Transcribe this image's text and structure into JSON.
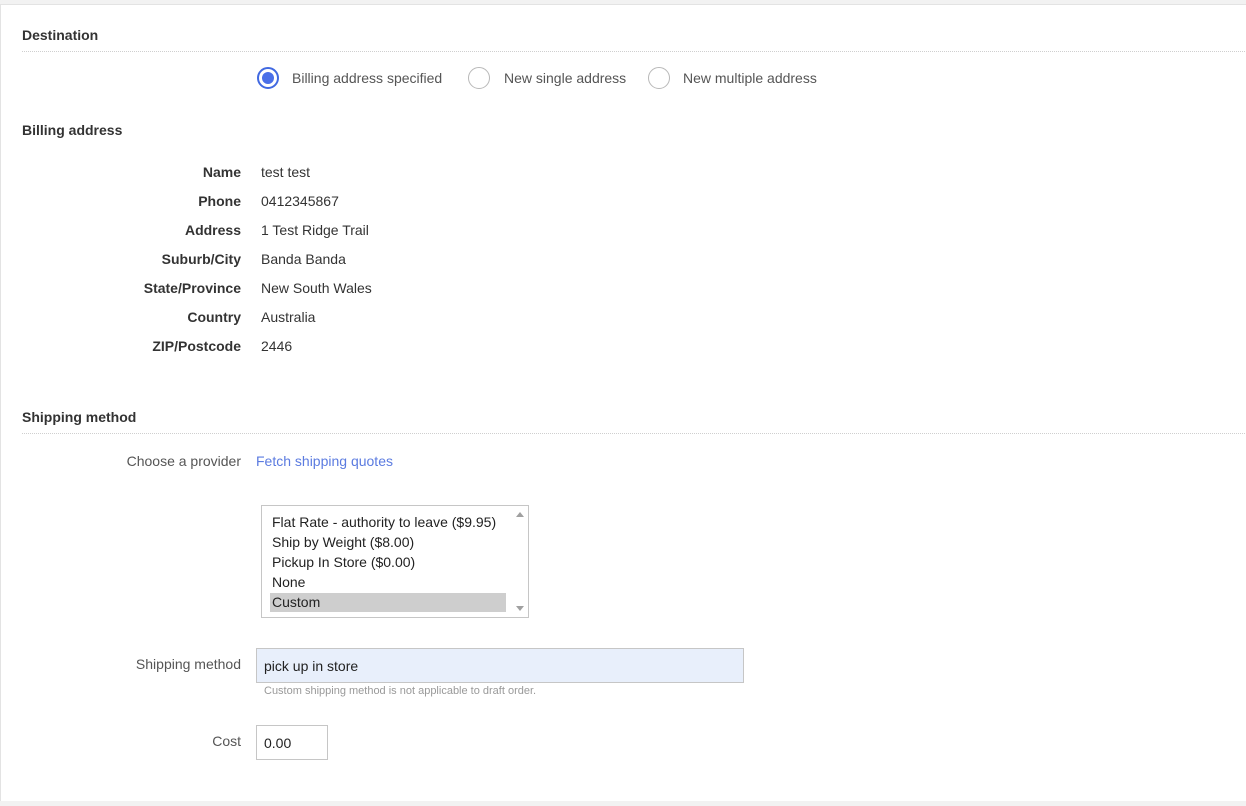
{
  "destination": {
    "title": "Destination",
    "options": [
      {
        "label": "Billing address specified",
        "checked": true
      },
      {
        "label": "New single address",
        "checked": false
      },
      {
        "label": "New multiple address",
        "checked": false
      }
    ]
  },
  "billing": {
    "title": "Billing address",
    "fields": [
      {
        "label": "Name",
        "value": "test test"
      },
      {
        "label": "Phone",
        "value": "0412345867"
      },
      {
        "label": "Address",
        "value": "1 Test Ridge Trail"
      },
      {
        "label": "Suburb/City",
        "value": "Banda Banda"
      },
      {
        "label": "State/Province",
        "value": "New South Wales"
      },
      {
        "label": "Country",
        "value": "Australia"
      },
      {
        "label": "ZIP/Postcode",
        "value": "2446"
      }
    ]
  },
  "shipping": {
    "title": "Shipping method",
    "provider_label": "Choose a provider",
    "fetch_link": "Fetch shipping quotes",
    "methods": [
      {
        "label": "Flat Rate - authority to leave ($9.95)",
        "selected": false
      },
      {
        "label": "Ship by Weight ($8.00)",
        "selected": false
      },
      {
        "label": "Pickup In Store ($0.00)",
        "selected": false
      },
      {
        "label": "None",
        "selected": false
      },
      {
        "label": "Custom",
        "selected": true
      }
    ],
    "method_label": "Shipping method",
    "method_value": "pick up in store",
    "method_hint": "Custom shipping method is not applicable to draft order.",
    "cost_label": "Cost",
    "cost_value": "0.00"
  },
  "colors": {
    "accent": "#4a6fe8",
    "link": "#5b7be0",
    "input_highlight": "#e8effb"
  }
}
